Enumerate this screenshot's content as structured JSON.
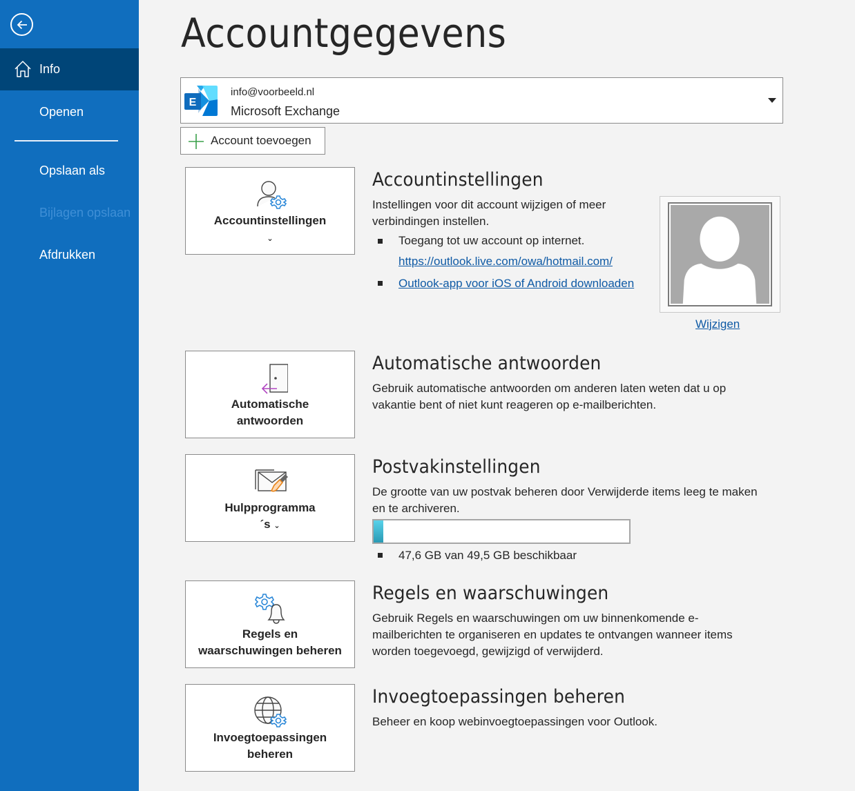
{
  "sidebar": {
    "back_icon": "arrow-left-circle-icon",
    "items": [
      {
        "label": "Info",
        "icon": "home-icon",
        "active": true
      },
      {
        "label": "Openen"
      },
      {
        "label": "Opslaan als"
      },
      {
        "label": "Bijlagen opslaan",
        "disabled": true
      },
      {
        "label": "Afdrukken"
      }
    ]
  },
  "page": {
    "title": "Accountgegevens"
  },
  "account": {
    "email": "info@voorbeeld.nl",
    "type": "Microsoft Exchange",
    "icon": "exchange-icon"
  },
  "add_account": {
    "label": "Account toevoegen",
    "icon": "plus-icon"
  },
  "sections": {
    "account_settings": {
      "tile_label": "Accountinstellingen",
      "tile_chevron": "⌄",
      "title": "Accountinstellingen",
      "desc": "Instellingen voor dit account wijzigen of meer verbindingen instellen.",
      "bullet1": "Toegang tot uw account op internet.",
      "link1": "https://outlook.live.com/owa/hotmail.com/",
      "link2": "Outlook-app voor iOS of Android downloaden",
      "photo_link": "Wijzigen"
    },
    "auto_replies": {
      "tile_label_line1": "Automatische",
      "tile_label_line2": "antwoorden",
      "title": "Automatische antwoorden",
      "desc": "Gebruik automatische antwoorden om anderen laten weten dat u op vakantie bent of niet kunt reageren op e-mailberichten."
    },
    "mailbox": {
      "tile_label_line1": "Hulpprogramma",
      "tile_label_line2": "´s",
      "tile_chevron": "⌄",
      "title": "Postvakinstellingen",
      "desc": "De grootte van uw postvak beheren door Verwijderde items leeg te maken en te archiveren.",
      "usage_fraction": 0.038,
      "storage_text": "47,6 GB van 49,5 GB beschikbaar",
      "bar_color": "#3bb8d3"
    },
    "rules": {
      "tile_label_line1": "Regels en",
      "tile_label_line2": "waarschuwingen beheren",
      "title": "Regels en waarschuwingen",
      "desc": "Gebruik Regels en waarschuwingen om uw binnenkomende e-mailberichten te organiseren en updates te ontvangen wanneer items worden toegevoegd, gewijzigd of verwijderd."
    },
    "addins": {
      "tile_label_line1": "Invoegtoepassingen",
      "tile_label_line2": "beheren",
      "title": "Invoegtoepassingen beheren",
      "desc": "Beheer en koop webinvoegtoepassingen voor Outlook."
    }
  },
  "colors": {
    "sidebar": "#106ebe",
    "sidebar_active": "#004578",
    "link": "#0f5aa5",
    "accent_gear": "#2b88d8",
    "accent_purple": "#b146c2",
    "accent_orange": "#e8851a"
  }
}
